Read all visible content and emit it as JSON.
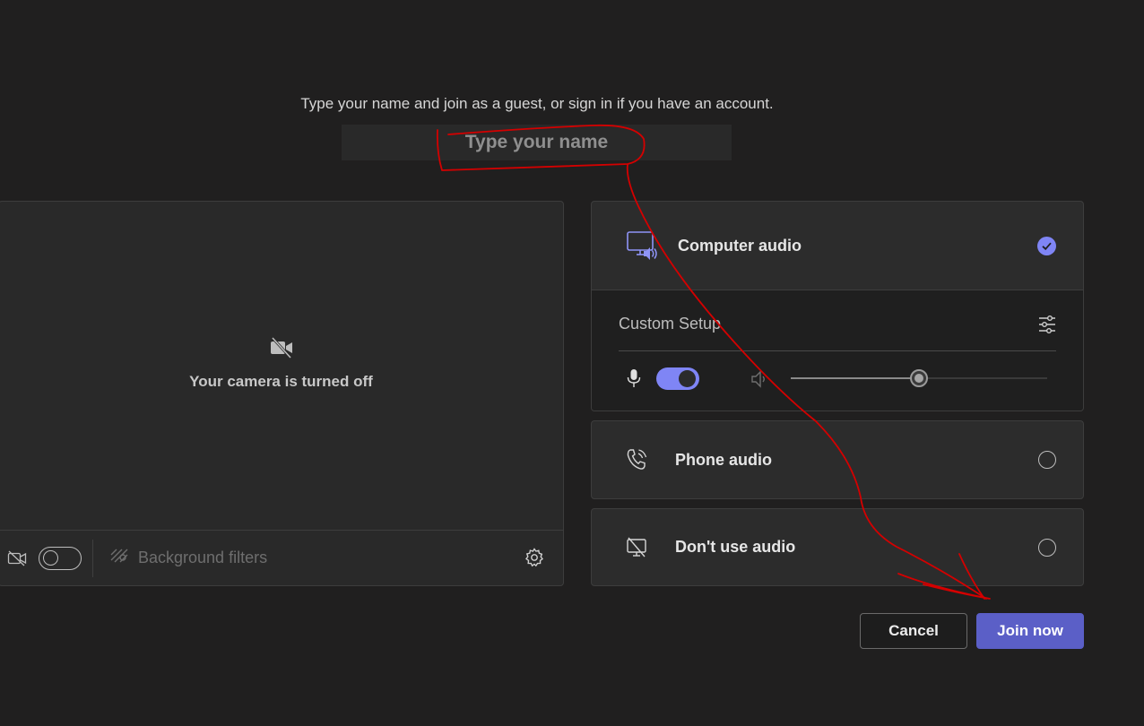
{
  "prompt": "Type your name and join as a guest, or sign in if you have an account.",
  "name_input": {
    "placeholder": "Type your name",
    "value": ""
  },
  "video": {
    "camera_status": "Your camera is turned off",
    "camera_toggle_on": false,
    "background_filters_label": "Background filters"
  },
  "audio": {
    "computer": {
      "label": "Computer audio",
      "selected": true
    },
    "custom_setup": {
      "label": "Custom Setup",
      "mic_on": true,
      "speaker_volume": 0.5
    },
    "phone": {
      "label": "Phone audio",
      "selected": false
    },
    "none": {
      "label": "Don't use audio",
      "selected": false
    }
  },
  "buttons": {
    "cancel": "Cancel",
    "join": "Join now"
  },
  "colors": {
    "background": "#201f1f",
    "accent": "#7f85f5",
    "join_button": "#5b5fc7",
    "annotation": "#d40000"
  },
  "icons": {
    "camera_off": "video-off-icon",
    "computer_audio": "monitor-speaker-icon",
    "phone_audio": "phone-icon",
    "no_audio": "screen-off-icon",
    "settings": "gear-icon",
    "custom_setup": "sliders-icon",
    "mic": "microphone-icon",
    "speaker": "speaker-icon",
    "background_filters": "background-filters-icon"
  }
}
